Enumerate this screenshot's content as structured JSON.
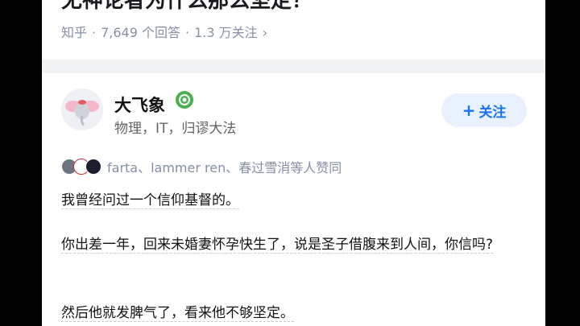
{
  "question": {
    "title": "无神论者为什么那么坚定？",
    "source": "知乎",
    "answer_count": "7,649 个回答",
    "follower_count": "1.3 万关注",
    "chevron_icon": "chevron-right-icon"
  },
  "answer": {
    "author": {
      "name": "大飞象",
      "bio": "物理，IT，归谬大法",
      "badge_icon": "verified-badge-icon",
      "follow_label": "关注",
      "follow_icon": "plus-icon"
    },
    "voters_text": "farta、lammer ren、春过雪消等人赞同",
    "paragraphs": [
      "我曾经问过一个信仰基督的。",
      "你出差一年，回来未婚妻怀孕快生了，说是圣子借腹来到人间，你信吗?",
      "然后他就发脾气了，看来他不够坚定。"
    ]
  },
  "colors": {
    "accent": "#1772f6",
    "follow_bg": "#e9f1ff",
    "meta_text": "#8590a6",
    "backdrop": "#000000"
  }
}
